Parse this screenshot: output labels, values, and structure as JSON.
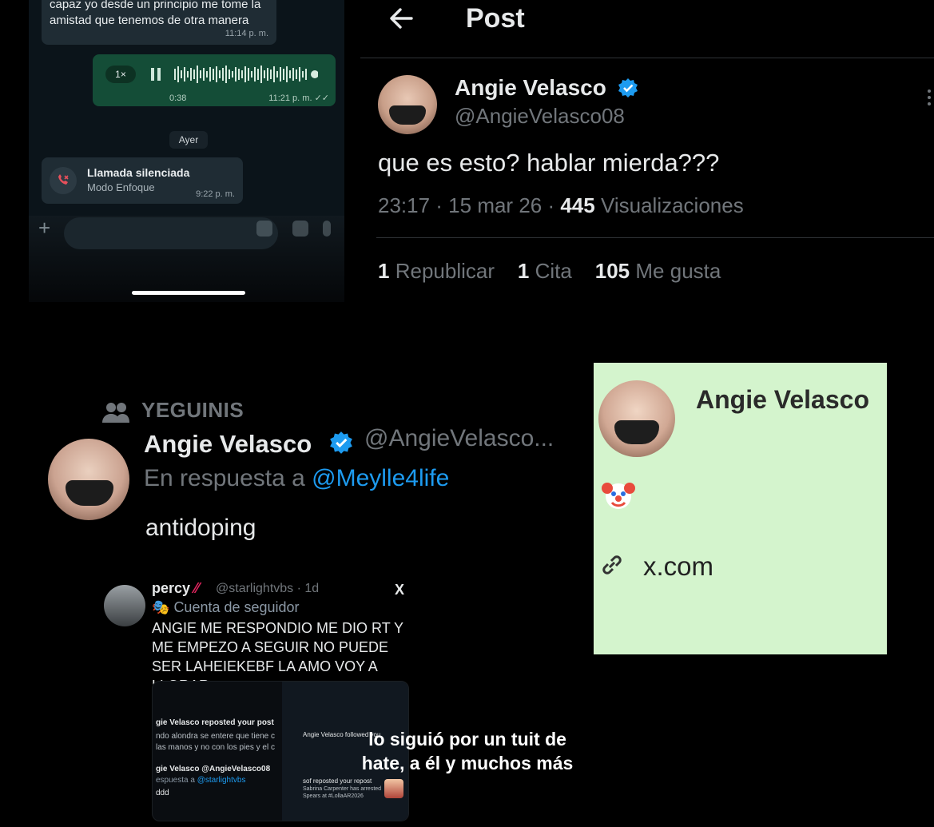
{
  "whatsapp": {
    "msg1": {
      "text": "capaz yo desde un principio me tome la amistad que tenemos de otra manera",
      "time": "11:14 p. m."
    },
    "voice": {
      "speed": "1×",
      "duration": "0:38",
      "time": "11:21 p. m."
    },
    "date_chip": "Ayer",
    "call": {
      "title": "Llamada silenciada",
      "subtitle": "Modo Enfoque",
      "time": "9:22 p. m."
    },
    "accent": "#144d37"
  },
  "post": {
    "header": "Post",
    "name": "Angie Velasco",
    "handle": "@AngieVelasco08",
    "text": "que es esto? hablar mierda???",
    "time_date": "23:17 · 15 mar 26 · ",
    "views_count": "445",
    "views_label": "Visualizaciones",
    "reposts_count": "1",
    "reposts_label": "Republicar",
    "quotes_count": "1",
    "quotes_label": "Cita",
    "likes_count": "105",
    "likes_label": "Me gusta"
  },
  "reply": {
    "group": "YEGUINIS",
    "name": "Angie Velasco",
    "handle": "@AngieVelasco...",
    "in_reply_prefix": "En respuesta a ",
    "in_reply_user": "@Meylle4life",
    "body": "antidoping"
  },
  "card": {
    "name": "Angie Velasco",
    "emoji": "clown-face",
    "link": "x.com",
    "background": "#d4f4cd"
  },
  "percy": {
    "name": "percy",
    "handle": "@starlightvbs · 1d",
    "x_logo": "X",
    "badge": "Cuenta de seguidor",
    "text": "ANGIE ME RESPONDIO ME DIO RT Y ME EMPEZO A SEGUIR NO PUEDE SER LAHEIEKEBF LA AMO VOY A LLORAR",
    "shot": {
      "reposted": "gie Velasco reposted your post",
      "reposted_text": "ndo alondra se entere que tiene c las manos y no con los pies y el c",
      "reply_name": "gie Velasco @AngieVelasco08",
      "reply_prefix": "espuesta a ",
      "reply_user": "@starlightvbs",
      "reply_body": "ddd",
      "followed": "Angie Velasco followed you",
      "repost2": "sof reposted your repost",
      "repost2_text": "Sabrina Carpenter has arrested Spears at #LollaAR2026"
    }
  },
  "caption": "lo siguió por un tuit de hate, a él y muchos más"
}
